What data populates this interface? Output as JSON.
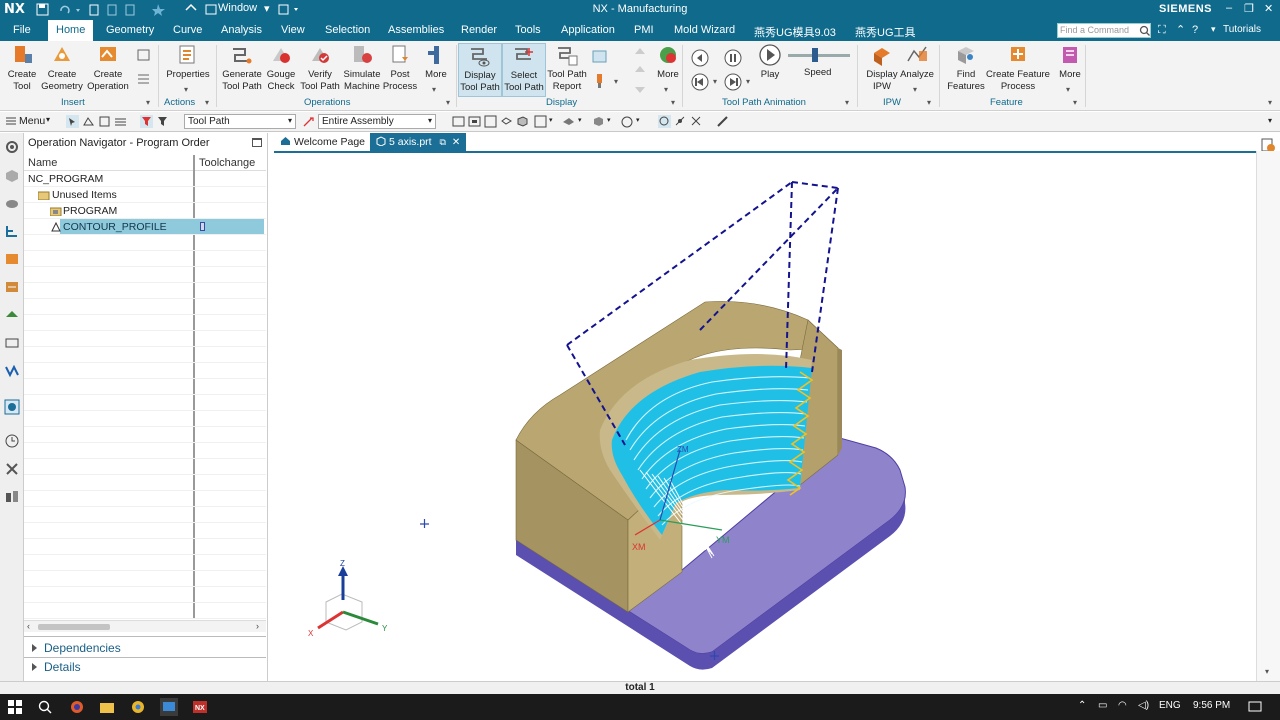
{
  "app": {
    "logo": "NX",
    "window_menu": "Window",
    "title": "NX - Manufacturing",
    "brand": "SIEMENS"
  },
  "menu_tabs": [
    "File",
    "Home",
    "Geometry",
    "Curve",
    "Analysis",
    "View",
    "Selection",
    "Assemblies",
    "Render",
    "Tools",
    "Application",
    "PMI",
    "Mold Wizard",
    "燕秀UG模具9.03",
    "燕秀UG工具"
  ],
  "active_tab": "Home",
  "search": {
    "placeholder": "Find a Command"
  },
  "tutorials": "Tutorials",
  "ribbon": {
    "insert": {
      "group": "Insert",
      "create_tool": "Create\nTool",
      "create_geometry": "Create\nGeometry",
      "create_operation": "Create\nOperation"
    },
    "actions": {
      "group": "Actions",
      "properties": "Properties"
    },
    "operations": {
      "group": "Operations",
      "generate": "Generate\nTool Path",
      "gouge": "Gouge\nCheck",
      "verify": "Verify\nTool Path",
      "simulate": "Simulate\nMachine",
      "post": "Post\nProcess",
      "more": "More"
    },
    "display": {
      "group": "Display",
      "display_tool_path": "Display\nTool Path",
      "select_tool_path": "Select\nTool Path",
      "report": "Tool Path\nReport",
      "more": "More"
    },
    "animation": {
      "group": "Tool Path Animation",
      "play": "Play",
      "speed": "Speed"
    },
    "ipw": {
      "group": "IPW",
      "display_ipw": "Display\nIPW",
      "analyze": "Analyze"
    },
    "feature": {
      "group": "Feature",
      "find": "Find\nFeatures",
      "create_process": "Create Feature\nProcess",
      "more": "More"
    }
  },
  "toolbar2": {
    "menu": "Menu",
    "filter": "Tool Path",
    "scope": "Entire Assembly"
  },
  "navigator": {
    "title": "Operation Navigator - Program Order",
    "col_name": "Name",
    "col_toolchange": "Toolchange",
    "rows": [
      "NC_PROGRAM",
      "Unused Items",
      "PROGRAM",
      "CONTOUR_PROFILE"
    ],
    "dependencies": "Dependencies",
    "details": "Details"
  },
  "doc_tabs": {
    "welcome": "Welcome Page",
    "part": "5 axis.prt"
  },
  "viewport": {
    "csys_x": "XM",
    "csys_y": "YM",
    "csys_z": "ZM",
    "triad_x": "X",
    "triad_y": "Y",
    "triad_z": "Z"
  },
  "status": {
    "text": "total 1"
  },
  "taskbar": {
    "lang": "ENG",
    "time": "9:56 PM"
  },
  "colors": {
    "accent": "#0f6a8c",
    "part_body": "#b9a671",
    "floor": "#8f84cc",
    "toolpath": "#1ec7e8",
    "tool_path_lead": "#f4c020",
    "dashed_path": "#13138f"
  }
}
